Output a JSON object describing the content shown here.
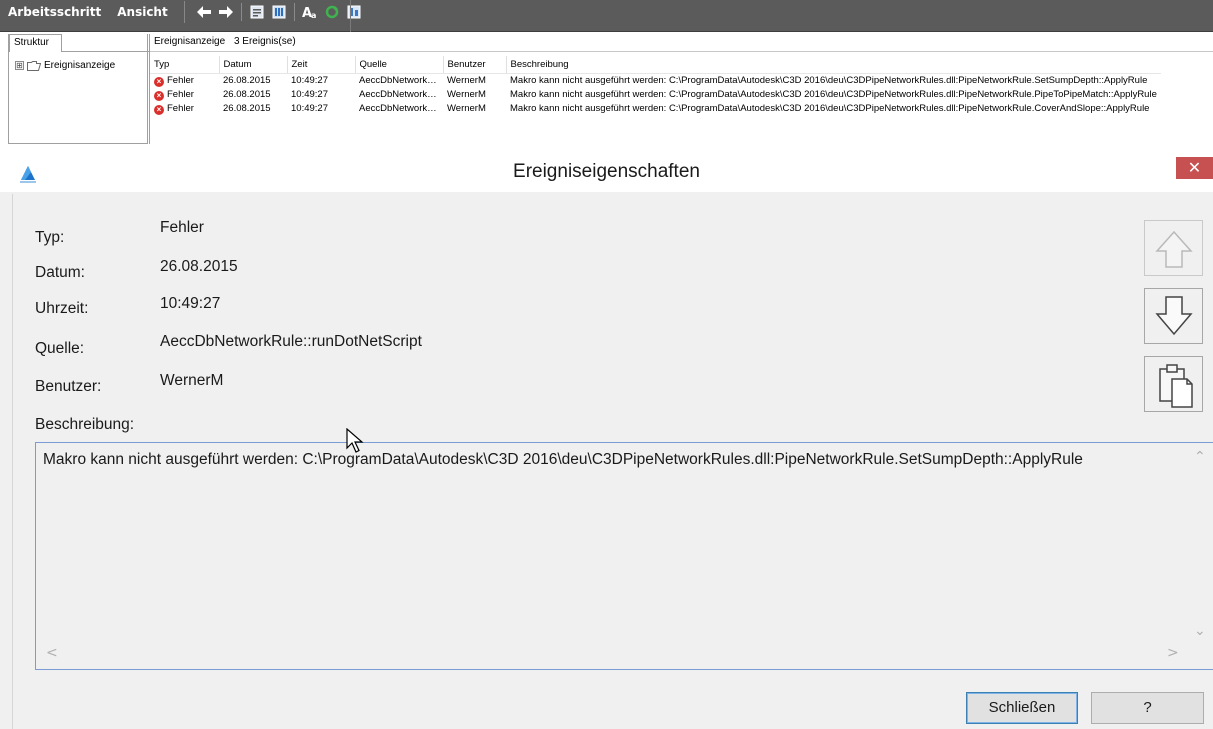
{
  "menubar": {
    "items": [
      "Arbeitsschritt",
      "Ansicht"
    ],
    "toolbar_icons": [
      "back-arrow-icon",
      "forward-arrow-icon",
      "properties-icon",
      "list-view-icon",
      "font-icon",
      "refresh-icon",
      "filter-icon"
    ]
  },
  "left_panel": {
    "tab_label": "Struktur",
    "tree": {
      "root_label": "Ereignisanzeige",
      "expander": "⊞"
    }
  },
  "right_panel": {
    "header_title": "Ereignisanzeige",
    "header_count": "3 Ereignis(se)",
    "columns": [
      "Typ",
      "Datum",
      "Zeit",
      "Quelle",
      "Benutzer",
      "Beschreibung"
    ],
    "rows": [
      {
        "typ": "Fehler",
        "datum": "26.08.2015",
        "zeit": "10:49:27",
        "quelle": "AeccDbNetwork…",
        "benutzer": "WernerM",
        "beschreibung": "Makro kann nicht ausgeführt werden: C:\\ProgramData\\Autodesk\\C3D 2016\\deu\\C3DPipeNetworkRules.dll:PipeNetworkRule.SetSumpDepth::ApplyRule"
      },
      {
        "typ": "Fehler",
        "datum": "26.08.2015",
        "zeit": "10:49:27",
        "quelle": "AeccDbNetwork…",
        "benutzer": "WernerM",
        "beschreibung": "Makro kann nicht ausgeführt werden: C:\\ProgramData\\Autodesk\\C3D 2016\\deu\\C3DPipeNetworkRules.dll:PipeNetworkRule.PipeToPipeMatch::ApplyRule"
      },
      {
        "typ": "Fehler",
        "datum": "26.08.2015",
        "zeit": "10:49:27",
        "quelle": "AeccDbNetwork…",
        "benutzer": "WernerM",
        "beschreibung": "Makro kann nicht ausgeführt werden: C:\\ProgramData\\Autodesk\\C3D 2016\\deu\\C3DPipeNetworkRules.dll:PipeNetworkRule.CoverAndSlope::ApplyRule"
      }
    ]
  },
  "dialog": {
    "title": "Ereigniseigenschaften",
    "close_glyph": "✕",
    "labels": {
      "typ": "Typ:",
      "datum": "Datum:",
      "uhrzeit": "Uhrzeit:",
      "quelle": "Quelle:",
      "benutzer": "Benutzer:",
      "beschreibung": "Beschreibung:"
    },
    "values": {
      "typ": "Fehler",
      "datum": "26.08.2015",
      "uhrzeit": "10:49:27",
      "quelle": "AeccDbNetworkRule::runDotNetScript",
      "benutzer": "WernerM"
    },
    "description": "Makro kann nicht ausgeführt werden: C:\\ProgramData\\Autodesk\\C3D 2016\\deu\\C3DPipeNetworkRules.dll:PipeNetworkRule.SetSumpDepth::ApplyRule",
    "scroll_glyphs": {
      "up": "⌃",
      "down": "⌄",
      "left": "<",
      "right": ">"
    },
    "buttons": {
      "close": "Schließen",
      "help": "?"
    },
    "side_buttons": [
      "up-arrow-icon",
      "down-arrow-icon",
      "clipboard-icon"
    ]
  },
  "colors": {
    "menubar": "#5b5b5b",
    "error": "#d9302c",
    "close_button": "#c75050",
    "description_border": "#7a9cd3"
  }
}
